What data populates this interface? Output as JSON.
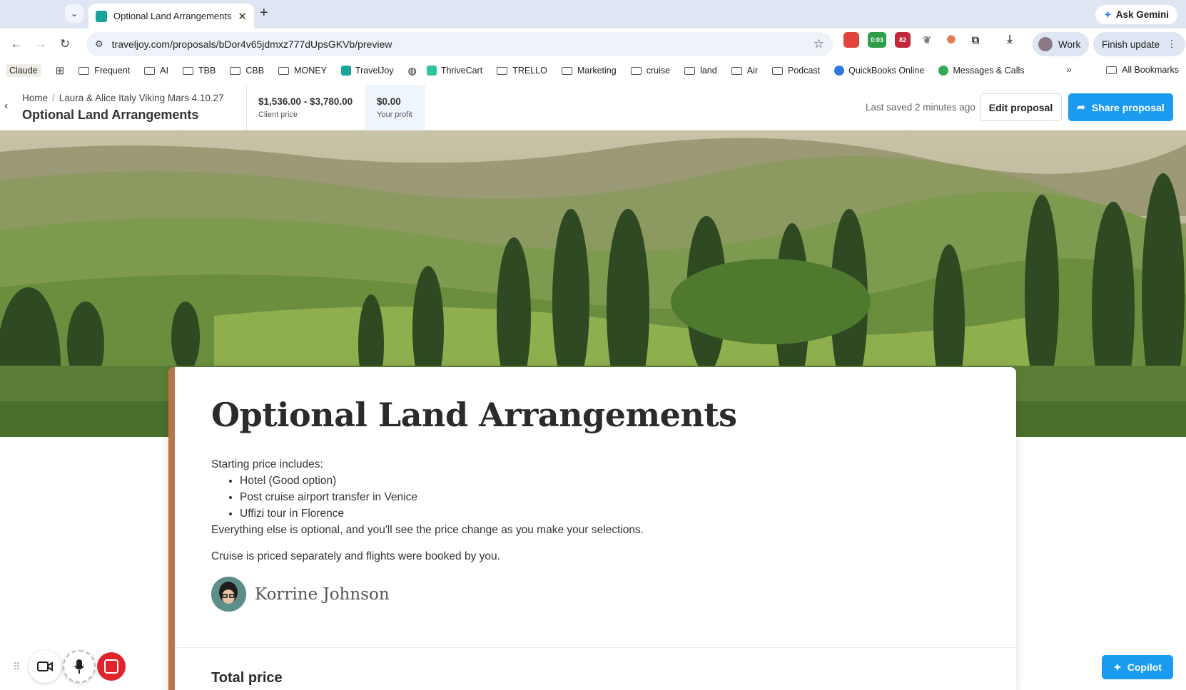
{
  "browser": {
    "tab_title": "Optional Land Arrangements",
    "url": "traveljoy.com/proposals/bDor4v65jdmxz777dUpsGKVb/preview",
    "ask_gemini": "Ask Gemini",
    "profile_label": "Work",
    "finish_update": "Finish update",
    "ext_timer": "0:03",
    "ext_badge": "82"
  },
  "bookmarks": {
    "items": [
      "Claude",
      "Frequent",
      "AI",
      "TBB",
      "CBB",
      "MONEY",
      "TravelJoy",
      "ThriveCart",
      "TRELLO",
      "Marketing",
      "cruise",
      "land",
      "Air",
      "Podcast",
      "QuickBooks Online",
      "Messages & Calls"
    ],
    "all": "All Bookmarks"
  },
  "header": {
    "crumb_home": "Home",
    "crumb_trip": "Laura & Alice Italy Viking Mars 4.10.27",
    "title": "Optional Land Arrangements",
    "client_price": "$1,536.00 - $3,780.00",
    "client_price_label": "Client price",
    "profit": "$0.00",
    "profit_label": "Your profit",
    "saved": "Last saved 2 minutes ago",
    "edit": "Edit proposal",
    "share": "Share proposal"
  },
  "card": {
    "title": "Optional Land Arrangements",
    "intro": "Starting price includes:",
    "bullets": [
      "Hotel (Good option)",
      "Post cruise airport transfer in Venice",
      "Uffizi tour in Florence"
    ],
    "optional_note": "Everything else is optional, and you'll see the price change as you make your selections.",
    "cruise_note": "Cruise is priced separately and flights were booked by you.",
    "author": "Korrine Johnson",
    "total_label": "Total price"
  },
  "copilot": "Copilot",
  "colors": {
    "accent_blue": "#1a9bf0",
    "card_accent": "#b8754c"
  }
}
